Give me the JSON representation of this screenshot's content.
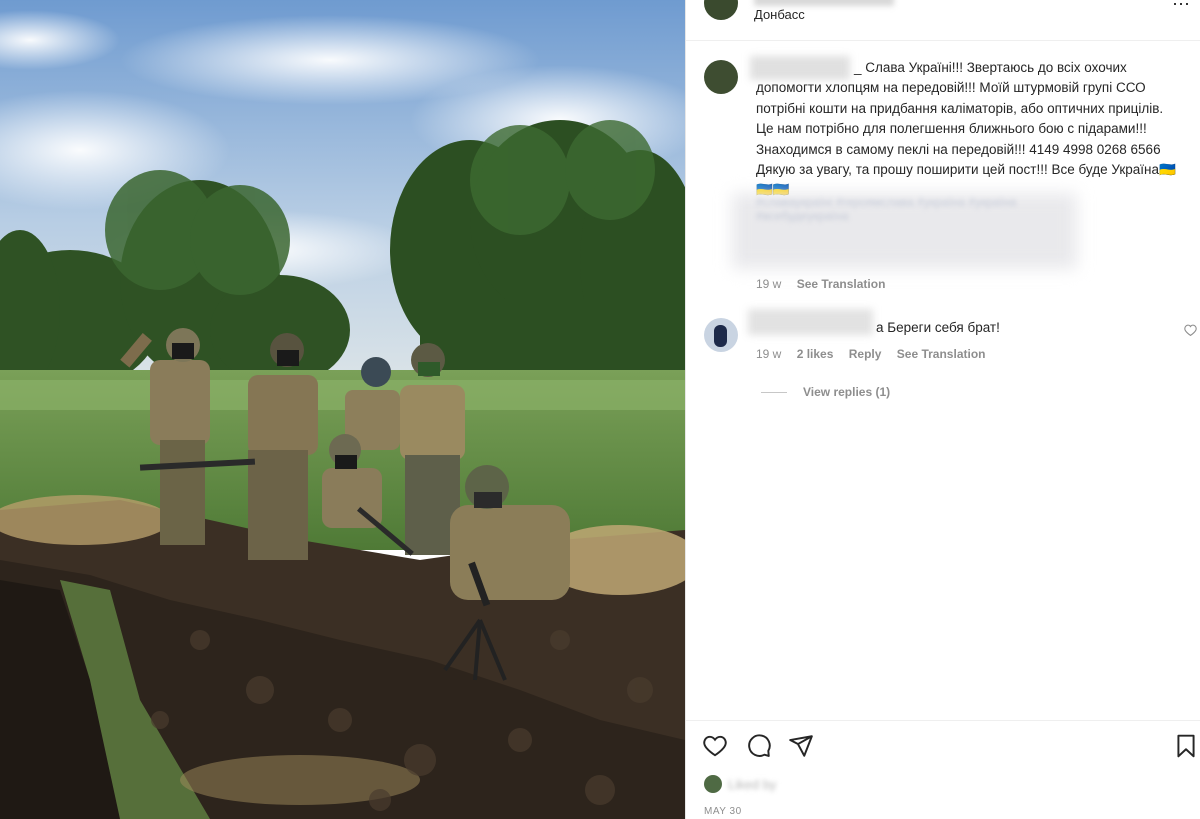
{
  "post": {
    "location": "Донбасс",
    "more_icon": "more-options-icon"
  },
  "caption": {
    "text": "_ Слава Україні!!! Звертаюсь до всіх охочих допомогти хлопцям на передовій!!! Моїй штурмовій групі ССО потрібні кошти на придбання каліматорів, або оптичних прицілів. Це нам потрібно для полегшення ближнього бою с підарами!!! Знаходимся в самому пеклі на передовій!!! 4149 4998 0268 6566 Дякую за увагу, та прошу поширити цей пост!!! Все буде Україна🇺🇦🇺🇦🇺🇦",
    "tags_blurred": "#славаукраїні #героямслава #україна #україна #всебудеукраїна",
    "time": "19 w",
    "see_translation": "See Translation"
  },
  "comment": {
    "text": "а Береги себя брат!",
    "time": "19 w",
    "likes": "2 likes",
    "reply": "Reply",
    "see_translation": "See Translation",
    "view_replies": "View replies (1)"
  },
  "footer": {
    "liked_by": "Liked by",
    "date": "MAY 30"
  },
  "colors": {
    "text": "#262626",
    "meta": "#8e8e8e",
    "border": "#efefef"
  }
}
